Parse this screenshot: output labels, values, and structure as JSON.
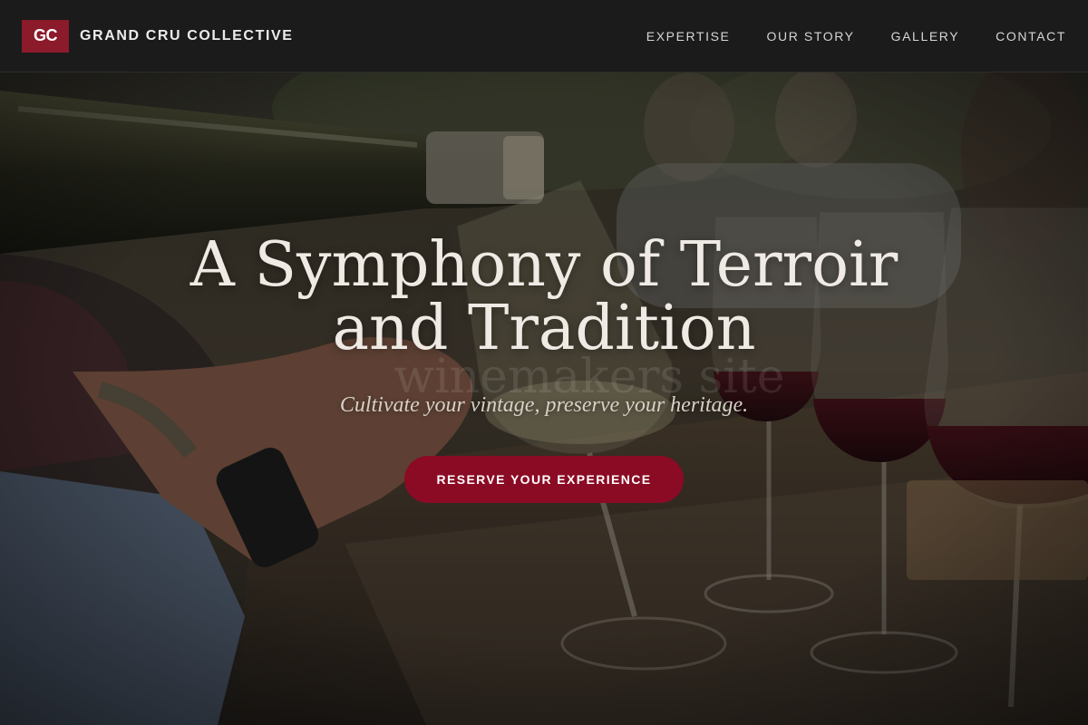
{
  "header": {
    "logo_text": "GC",
    "brand_name": "GRAND CRU COLLECTIVE",
    "nav": [
      {
        "label": "EXPERTISE"
      },
      {
        "label": "OUR STORY"
      },
      {
        "label": "GALLERY"
      },
      {
        "label": "CONTACT"
      }
    ]
  },
  "hero": {
    "title_line1": "A Symphony of Terroir",
    "title_line2": "and Tradition",
    "watermark_text": "winemakers site",
    "subtitle": "Cultivate your vintage, preserve your heritage.",
    "cta_label": "RESERVE YOUR EXPERIENCE"
  },
  "colors": {
    "accent": "#8b0a24",
    "logo_bg": "#8b1a2b",
    "header_bg": "#1b1b1b"
  }
}
